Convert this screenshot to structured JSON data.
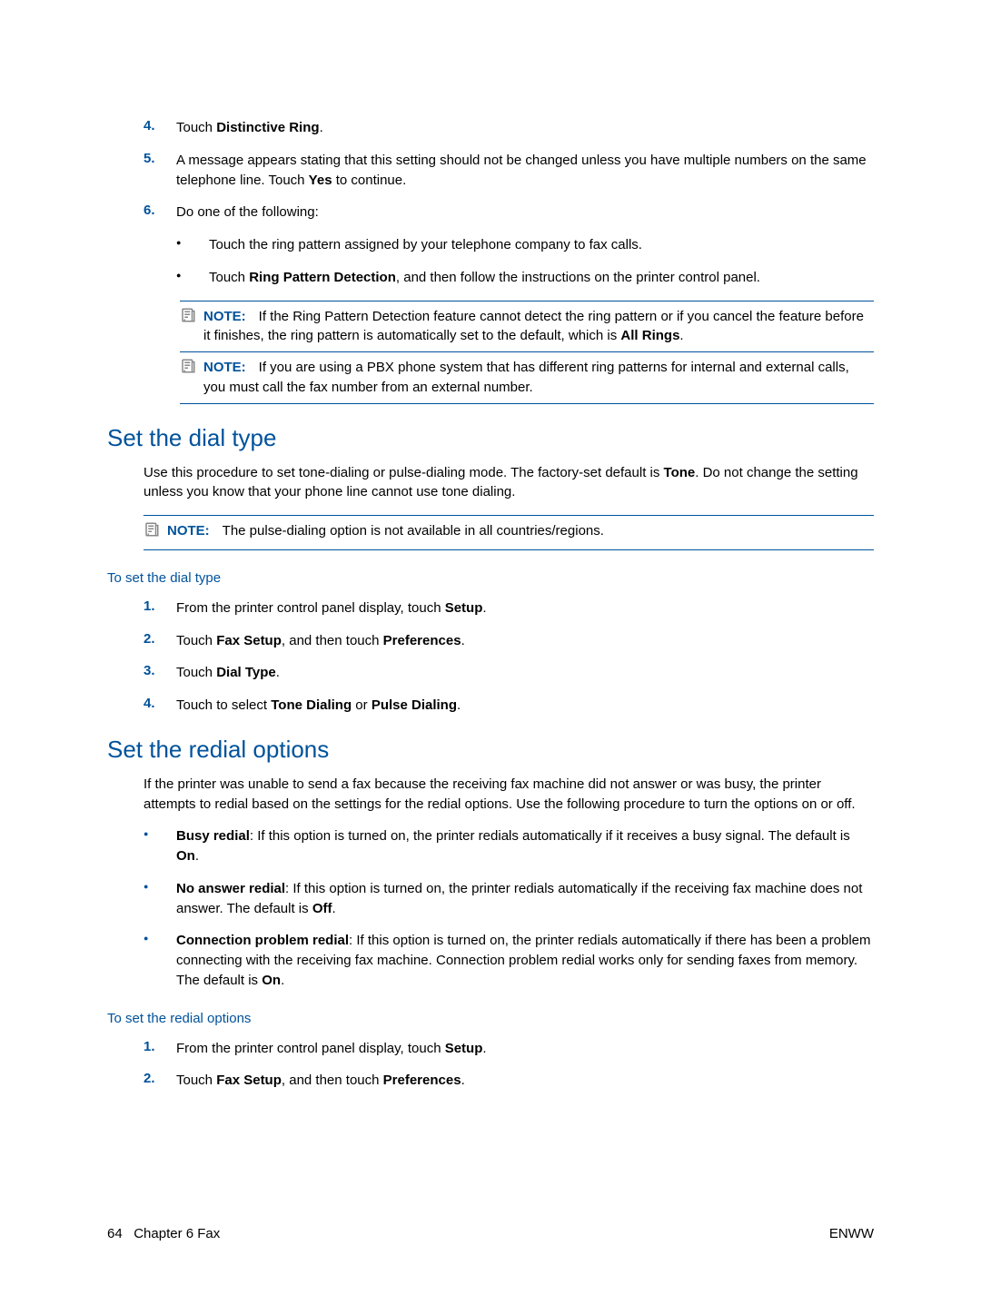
{
  "steps_top": [
    {
      "n": "4.",
      "html": "Touch <b>Distinctive Ring</b>."
    },
    {
      "n": "5.",
      "html": "A message appears stating that this setting should not be changed unless you have multiple numbers on the same telephone line. Touch <b>Yes</b> to continue."
    },
    {
      "n": "6.",
      "html": "Do one of the following:"
    }
  ],
  "sub_bullets": [
    "Touch the ring pattern assigned by your telephone company to fax calls.",
    "Touch <b>Ring Pattern Detection</b>, and then follow the instructions on the printer control panel."
  ],
  "notes_top": [
    {
      "label": "NOTE:",
      "html": "If the Ring Pattern Detection feature cannot detect the ring pattern or if you cancel the feature before it finishes, the ring pattern is automatically set to the default, which is <b>All Rings</b>."
    },
    {
      "label": "NOTE:",
      "html": "If you are using a PBX phone system that has different ring patterns for internal and external calls, you must call the fax number from an external number."
    }
  ],
  "section_dial_title": "Set the dial type",
  "section_dial_para": "Use this procedure to set tone-dialing or pulse-dialing mode. The factory-set default is <b>Tone</b>. Do not change the setting unless you know that your phone line cannot use tone dialing.",
  "note_dial": {
    "label": "NOTE:",
    "html": "The pulse-dialing option is not available in all countries/regions."
  },
  "subhead_dial": "To set the dial type",
  "steps_dial": [
    {
      "n": "1.",
      "html": "From the printer control panel display, touch <b>Setup</b>."
    },
    {
      "n": "2.",
      "html": "Touch <b>Fax Setup</b>, and then touch <b>Preferences</b>."
    },
    {
      "n": "3.",
      "html": "Touch <b>Dial Type</b>."
    },
    {
      "n": "4.",
      "html": "Touch to select <b>Tone Dialing</b> or <b>Pulse Dialing</b>."
    }
  ],
  "section_redial_title": "Set the redial options",
  "section_redial_para": "If the printer was unable to send a fax because the receiving fax machine did not answer or was busy, the printer attempts to redial based on the settings for the redial options. Use the following procedure to turn the options on or off.",
  "redial_bullets": [
    "<b>Busy redial</b>: If this option is turned on, the printer redials automatically if it receives a busy signal. The default is <b>On</b>.",
    "<b>No answer redial</b>: If this option is turned on, the printer redials automatically if the receiving fax machine does not answer. The default is <b>Off</b>.",
    "<b>Connection problem redial</b>: If this option is turned on, the printer redials automatically if there has been a problem connecting with the receiving fax machine. Connection problem redial works only for sending faxes from memory. The default is <b>On</b>."
  ],
  "subhead_redial": "To set the redial options",
  "steps_redial": [
    {
      "n": "1.",
      "html": "From the printer control panel display, touch <b>Setup</b>."
    },
    {
      "n": "2.",
      "html": "Touch <b>Fax Setup</b>, and then touch <b>Preferences</b>."
    }
  ],
  "footer": {
    "page": "64",
    "chapter": "Chapter 6   Fax",
    "right": "ENWW"
  }
}
